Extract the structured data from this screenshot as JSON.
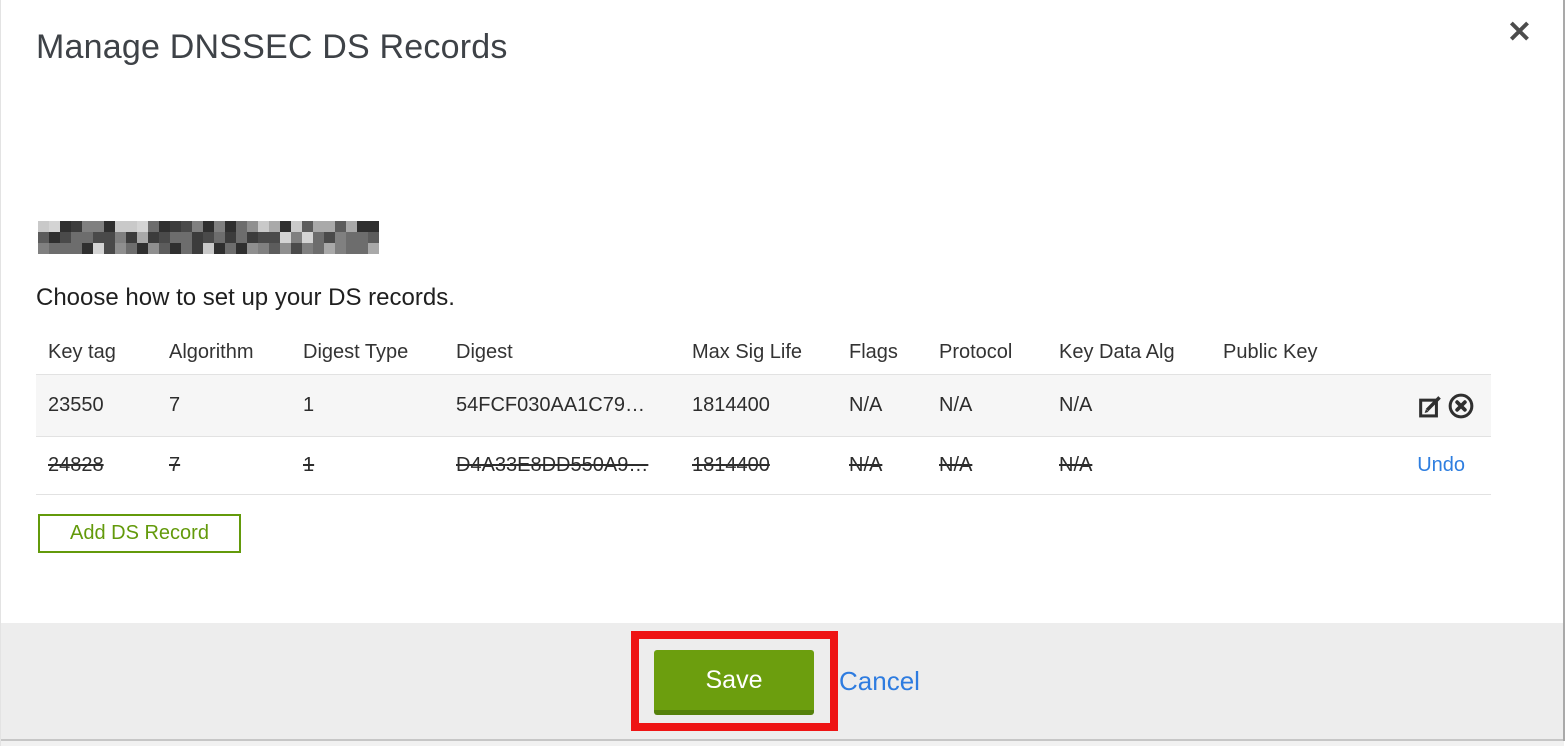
{
  "modal": {
    "title": "Manage DNSSEC DS Records",
    "close_glyph": "✕",
    "domain_redacted": true,
    "instruction": "Choose how to set up your DS records.",
    "table": {
      "columns": [
        "Key tag",
        "Algorithm",
        "Digest Type",
        "Digest",
        "Max Sig Life",
        "Flags",
        "Protocol",
        "Key Data Alg",
        "Public Key"
      ],
      "rows": [
        {
          "cells": [
            "23550",
            "7",
            "1",
            "54FCF030AA1C79…",
            "1814400",
            "N/A",
            "N/A",
            "N/A",
            ""
          ],
          "deleted": false,
          "actions": [
            "edit",
            "delete"
          ]
        },
        {
          "cells": [
            "24828",
            "7",
            "1",
            "D4A33E8DD550A9…",
            "1814400",
            "N/A",
            "N/A",
            "N/A",
            ""
          ],
          "deleted": true,
          "undo_label": "Undo"
        }
      ]
    },
    "add_button_label": "Add DS Record",
    "footer": {
      "save_label": "Save",
      "cancel_label": "Cancel"
    }
  },
  "colors": {
    "green_button": "#6c9e0e",
    "green_button_shadow": "#55810b",
    "green_outline": "#639a0b",
    "link_blue": "#2e7ee0",
    "annotation_red": "#ee1414",
    "row_stripe": "#f6f6f6",
    "footer_bg": "#ededed",
    "table_border": "#e2e2e2"
  }
}
